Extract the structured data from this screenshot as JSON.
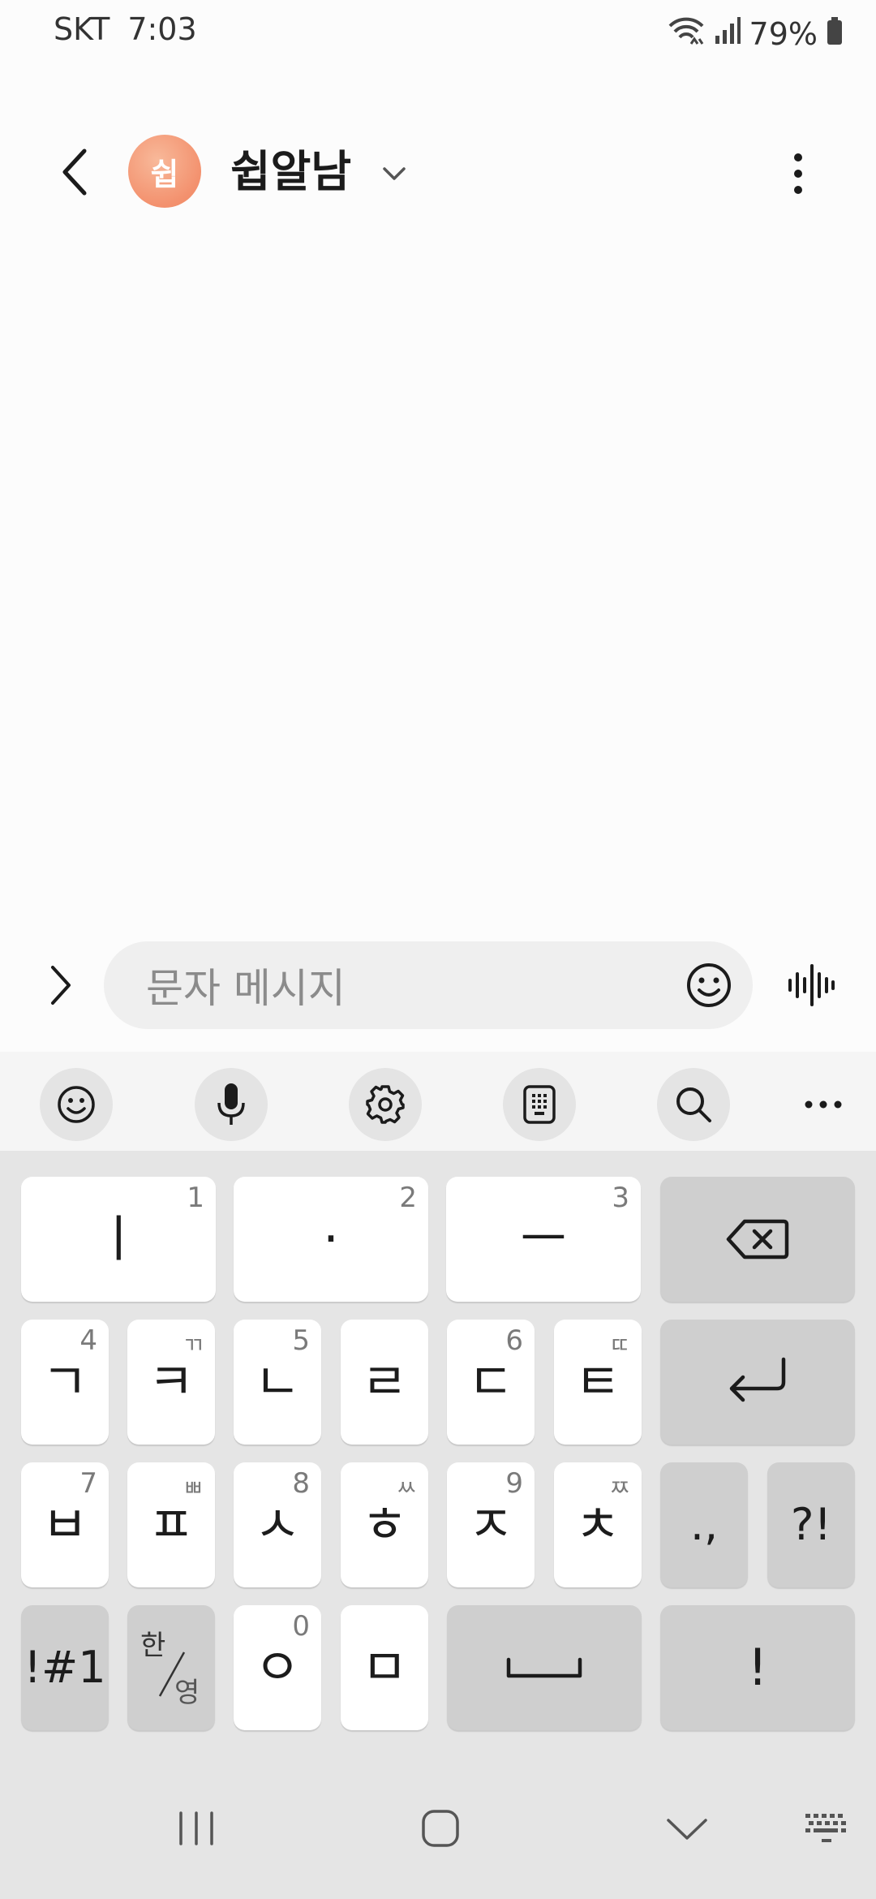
{
  "status_bar": {
    "carrier": "SKT",
    "time": "7:03",
    "battery": "79%"
  },
  "header": {
    "avatar_initial": "쉽",
    "contact_name": "쉽알남",
    "avatar_color": "#f3916e"
  },
  "composer": {
    "placeholder": "문자 메시지"
  },
  "keyboard": {
    "row1": [
      {
        "main": "ㅣ",
        "sub": "1"
      },
      {
        "main": "·",
        "sub": "2"
      },
      {
        "main": "ㅡ",
        "sub": "3"
      }
    ],
    "row2": [
      {
        "main": "ㄱ",
        "sub": "4"
      },
      {
        "main": "ㅋ",
        "sub": "ㄲ"
      },
      {
        "main": "ㄴ",
        "sub": "5"
      },
      {
        "main": "ㄹ",
        "sub": ""
      },
      {
        "main": "ㄷ",
        "sub": "6"
      },
      {
        "main": "ㅌ",
        "sub": "ㄸ"
      }
    ],
    "row3": [
      {
        "main": "ㅂ",
        "sub": "7"
      },
      {
        "main": "ㅍ",
        "sub": "ㅃ"
      },
      {
        "main": "ㅅ",
        "sub": "8"
      },
      {
        "main": "ㅎ",
        "sub": "ㅆ"
      },
      {
        "main": "ㅈ",
        "sub": "9"
      },
      {
        "main": "ㅊ",
        "sub": "ㅉ"
      },
      {
        "main": ".,",
        "sub": ""
      },
      {
        "main": "?!",
        "sub": ""
      }
    ],
    "row4": {
      "symbols": "!#1",
      "lang_top": "한",
      "lang_bottom": "영",
      "ieung": "ㅇ",
      "ieung_sub": "0",
      "mieum": "ㅁ",
      "excl": "!"
    }
  }
}
